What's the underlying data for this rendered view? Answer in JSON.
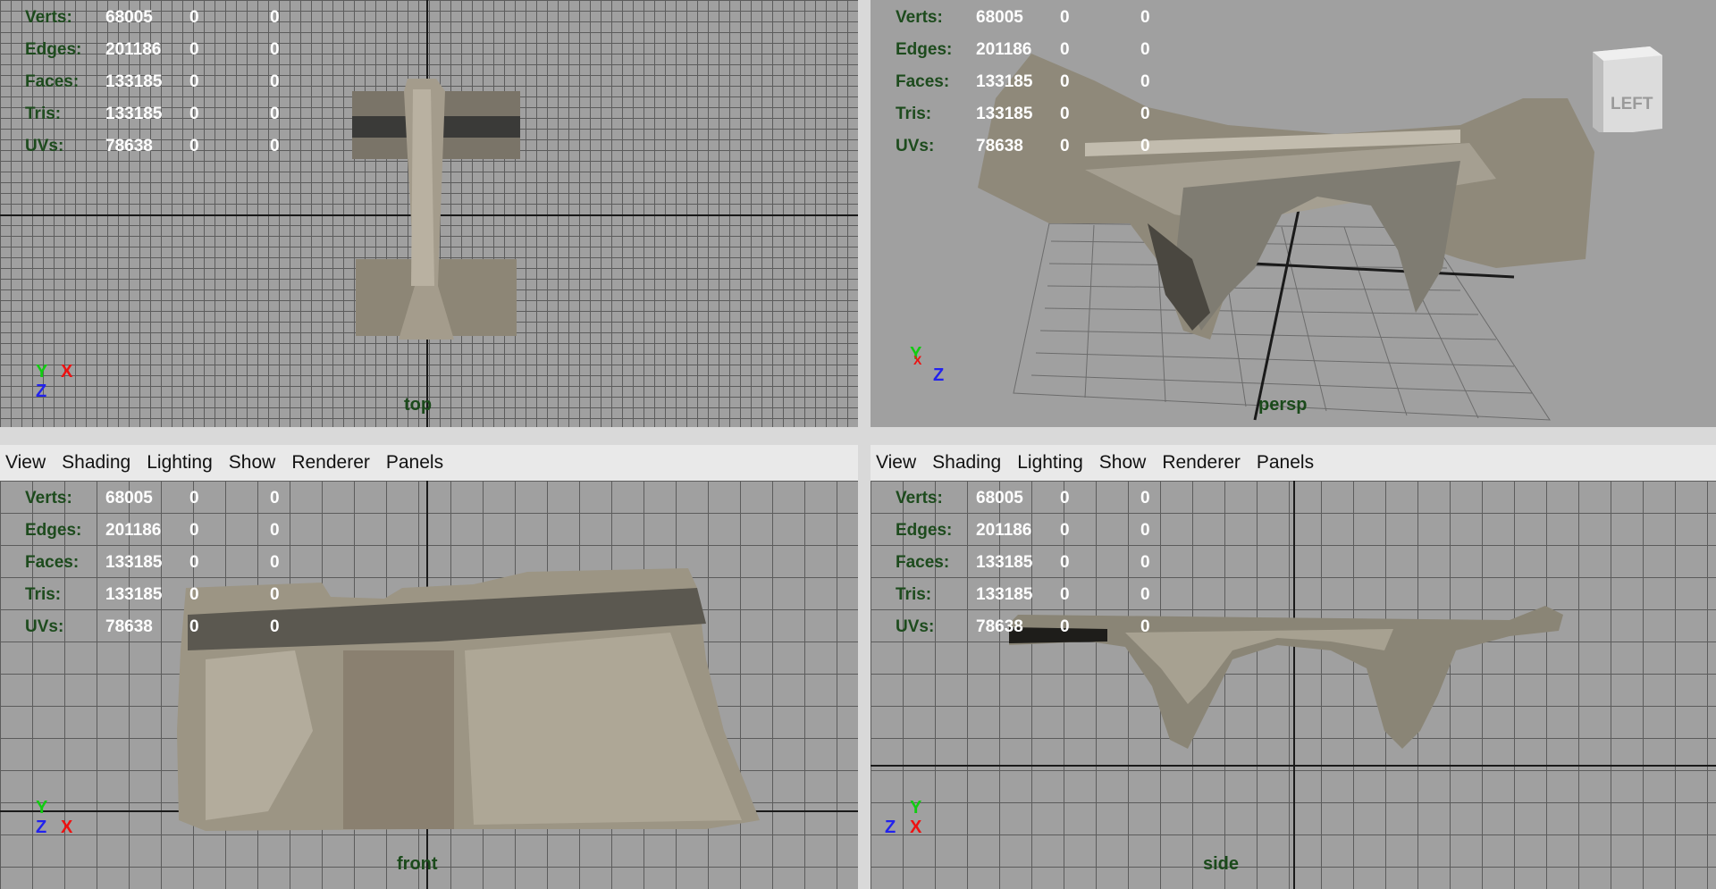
{
  "menu": [
    "View",
    "Shading",
    "Lighting",
    "Show",
    "Renderer",
    "Panels"
  ],
  "hud": {
    "rows": [
      {
        "label": "Verts:",
        "v1": "68005",
        "v2": "0",
        "v3": "0"
      },
      {
        "label": "Edges:",
        "v1": "201186",
        "v2": "0",
        "v3": "0"
      },
      {
        "label": "Faces:",
        "v1": "133185",
        "v2": "0",
        "v3": "0"
      },
      {
        "label": "Tris:",
        "v1": "133185",
        "v2": "0",
        "v3": "0"
      },
      {
        "label": "UVs:",
        "v1": "78638",
        "v2": "0",
        "v3": "0"
      }
    ]
  },
  "viewports": {
    "top": {
      "camera": "top"
    },
    "persp": {
      "camera": "persp"
    },
    "front": {
      "camera": "front"
    },
    "side": {
      "camera": "side"
    }
  },
  "axes": {
    "x": "X",
    "y": "Y",
    "z": "Z"
  },
  "viewcube": {
    "face": "LEFT"
  },
  "colors": {
    "viewport_bg": "#a0a0a0",
    "grid": "#5c5c5c",
    "hud_label": "#1d4b1d",
    "camera_label": "#1b4a1b",
    "active_border": "#7aa6d6"
  }
}
